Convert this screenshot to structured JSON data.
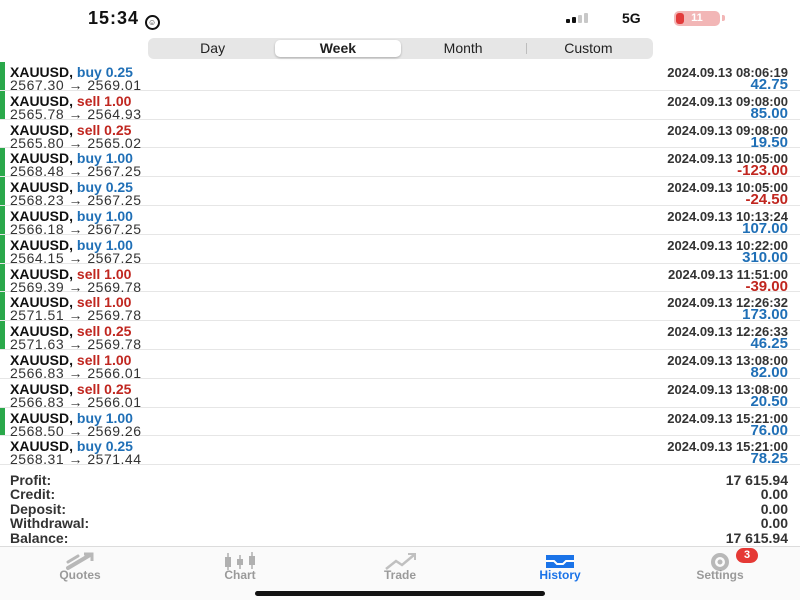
{
  "status_bar": {
    "time": "15:34",
    "network": "5G",
    "battery": "11"
  },
  "period_tabs": [
    {
      "label": "Day",
      "active": false
    },
    {
      "label": "Week",
      "active": true
    },
    {
      "label": "Month",
      "active": false
    },
    {
      "label": "Custom",
      "active": false
    }
  ],
  "trades": [
    {
      "symbol": "XAUUSD,",
      "direction": "buy",
      "volume": "0.25",
      "open": "2567.30",
      "close": "2569.01",
      "arrow": "→",
      "date": "2024.09.13 08:06:19",
      "profit": "42.75",
      "bar": true
    },
    {
      "symbol": "XAUUSD,",
      "direction": "sell",
      "volume": "1.00",
      "open": "2565.78",
      "close": "2564.93",
      "arrow": "→",
      "date": "2024.09.13 09:08:00",
      "profit": "85.00",
      "bar": true
    },
    {
      "symbol": "XAUUSD,",
      "direction": "sell",
      "volume": "0.25",
      "open": "2565.80",
      "close": "2565.02",
      "arrow": "→",
      "date": "2024.09.13 09:08:00",
      "profit": "19.50",
      "bar": false
    },
    {
      "symbol": "XAUUSD,",
      "direction": "buy",
      "volume": "1.00",
      "open": "2568.48",
      "close": "2567.25",
      "arrow": "→",
      "date": "2024.09.13 10:05:00",
      "profit": "-123.00",
      "bar": true
    },
    {
      "symbol": "XAUUSD,",
      "direction": "buy",
      "volume": "0.25",
      "open": "2568.23",
      "close": "2567.25",
      "arrow": "→",
      "date": "2024.09.13 10:05:00",
      "profit": "-24.50",
      "bar": true
    },
    {
      "symbol": "XAUUSD,",
      "direction": "buy",
      "volume": "1.00",
      "open": "2566.18",
      "close": "2567.25",
      "arrow": "→",
      "date": "2024.09.13 10:13:24",
      "profit": "107.00",
      "bar": true
    },
    {
      "symbol": "XAUUSD,",
      "direction": "buy",
      "volume": "1.00",
      "open": "2564.15",
      "close": "2567.25",
      "arrow": "→",
      "date": "2024.09.13 10:22:00",
      "profit": "310.00",
      "bar": true
    },
    {
      "symbol": "XAUUSD,",
      "direction": "sell",
      "volume": "1.00",
      "open": "2569.39",
      "close": "2569.78",
      "arrow": "→",
      "date": "2024.09.13 11:51:00",
      "profit": "-39.00",
      "bar": true
    },
    {
      "symbol": "XAUUSD,",
      "direction": "sell",
      "volume": "1.00",
      "open": "2571.51",
      "close": "2569.78",
      "arrow": "→",
      "date": "2024.09.13 12:26:32",
      "profit": "173.00",
      "bar": true
    },
    {
      "symbol": "XAUUSD,",
      "direction": "sell",
      "volume": "0.25",
      "open": "2571.63",
      "close": "2569.78",
      "arrow": "→",
      "date": "2024.09.13 12:26:33",
      "profit": "46.25",
      "bar": true
    },
    {
      "symbol": "XAUUSD,",
      "direction": "sell",
      "volume": "1.00",
      "open": "2566.83",
      "close": "2566.01",
      "arrow": "→",
      "date": "2024.09.13 13:08:00",
      "profit": "82.00",
      "bar": false
    },
    {
      "symbol": "XAUUSD,",
      "direction": "sell",
      "volume": "0.25",
      "open": "2566.83",
      "close": "2566.01",
      "arrow": "→",
      "date": "2024.09.13 13:08:00",
      "profit": "20.50",
      "bar": false
    },
    {
      "symbol": "XAUUSD,",
      "direction": "buy",
      "volume": "1.00",
      "open": "2568.50",
      "close": "2569.26",
      "arrow": "→",
      "date": "2024.09.13 15:21:00",
      "profit": "76.00",
      "bar": true
    },
    {
      "symbol": "XAUUSD,",
      "direction": "buy",
      "volume": "0.25",
      "open": "2568.31",
      "close": "2571.44",
      "arrow": "→",
      "date": "2024.09.13 15:21:00",
      "profit": "78.25",
      "bar": false
    }
  ],
  "summary": [
    {
      "label": "Profit:",
      "value": "17 615.94"
    },
    {
      "label": "Credit:",
      "value": "0.00"
    },
    {
      "label": "Deposit:",
      "value": "0.00"
    },
    {
      "label": "Withdrawal:",
      "value": "0.00"
    },
    {
      "label": "Balance:",
      "value": "17 615.94"
    }
  ],
  "tab_bar": [
    {
      "label": "Quotes",
      "icon": "quotes-icon",
      "active": false
    },
    {
      "label": "Chart",
      "icon": "chart-icon",
      "active": false
    },
    {
      "label": "Trade",
      "icon": "trade-icon",
      "active": false
    },
    {
      "label": "History",
      "icon": "history-icon",
      "active": true
    },
    {
      "label": "Settings",
      "icon": "settings-icon",
      "active": false,
      "badge": "3"
    }
  ],
  "colors": {
    "buy": "#1f6fb6",
    "sell": "#c0261f",
    "positive": "#1f6fb6",
    "negative": "#c0261f",
    "accent": "#1a73e8",
    "bar": "#2aa84a"
  }
}
